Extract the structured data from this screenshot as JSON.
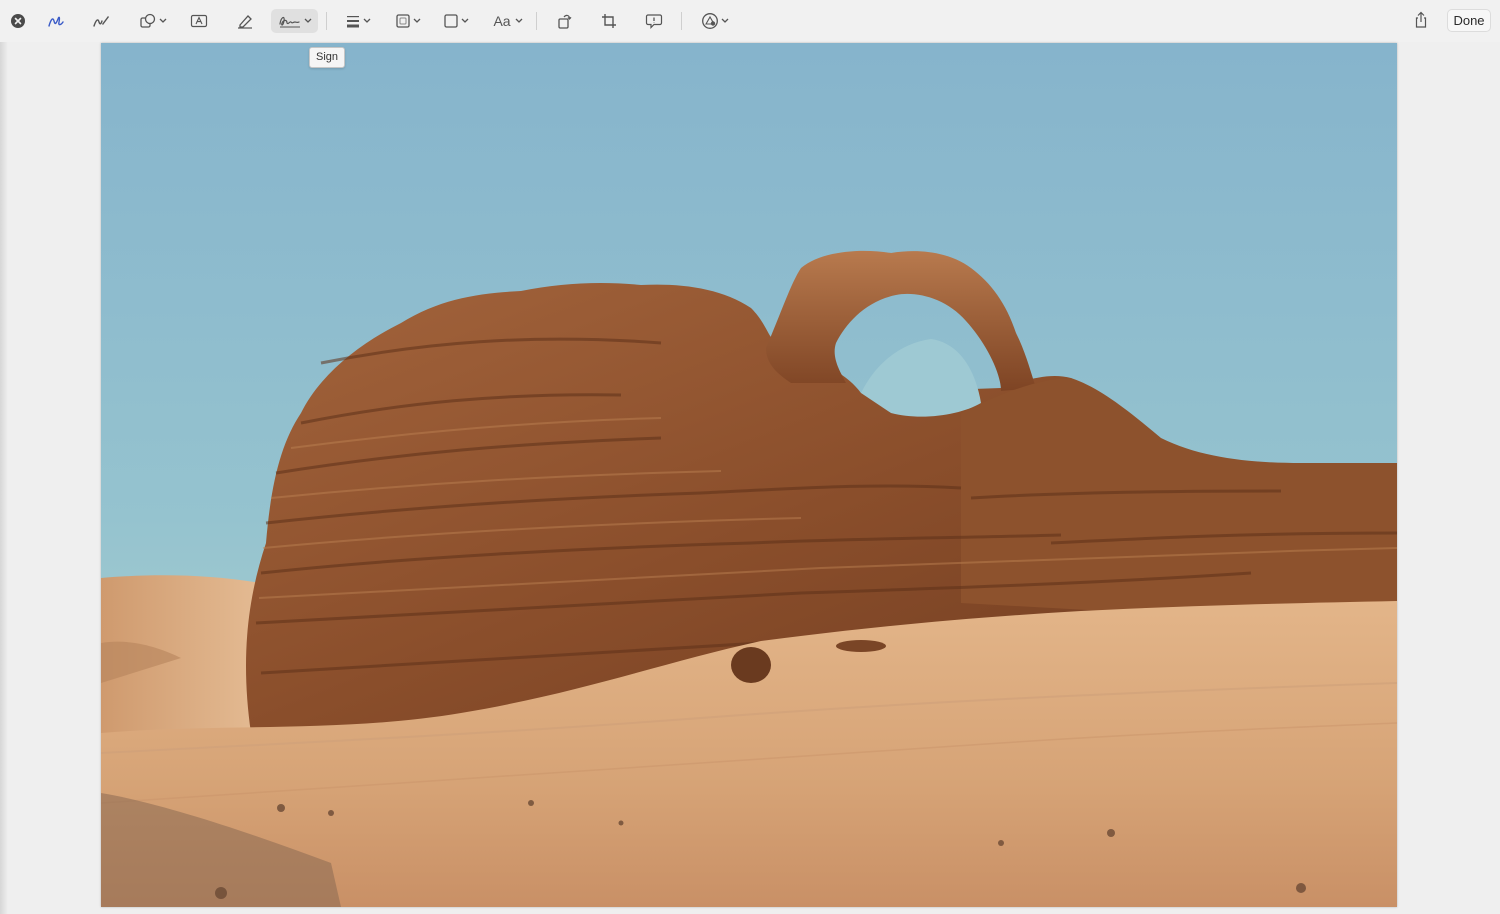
{
  "toolbar": {
    "close_icon": "close-circle-icon",
    "tools": [
      {
        "name": "sketch",
        "icon": "sketch-icon",
        "active_color": "#3a5bc7"
      },
      {
        "name": "draw",
        "icon": "draw-icon"
      },
      {
        "name": "shapes",
        "icon": "shapes-icon"
      },
      {
        "name": "text",
        "icon": "text-box-icon"
      },
      {
        "name": "highlight",
        "icon": "highlight-icon"
      },
      {
        "name": "sign",
        "icon": "signature-icon"
      },
      {
        "name": "shape-style",
        "icon": "line-style-icon"
      },
      {
        "name": "border-color",
        "icon": "border-color-icon"
      },
      {
        "name": "fill-color",
        "icon": "fill-color-icon"
      },
      {
        "name": "text-style",
        "icon": "text-style-icon",
        "label": "Aa"
      },
      {
        "name": "rotate",
        "icon": "rotate-icon"
      },
      {
        "name": "crop",
        "icon": "crop-icon"
      },
      {
        "name": "description",
        "icon": "description-icon"
      },
      {
        "name": "autofill",
        "icon": "markup-options-icon"
      }
    ],
    "share_icon": "share-icon",
    "done_label": "Done"
  },
  "tooltip": {
    "text": "Sign"
  },
  "image": {
    "description_icon": "desert-arch-photo",
    "colors": {
      "sky_top": "#86b4cc",
      "sky_bottom": "#a8d0d4",
      "rock": "#9a5a34",
      "rock_dark": "#5e3119",
      "sand": "#d9a77a",
      "sand_light": "#e7c09a"
    }
  }
}
